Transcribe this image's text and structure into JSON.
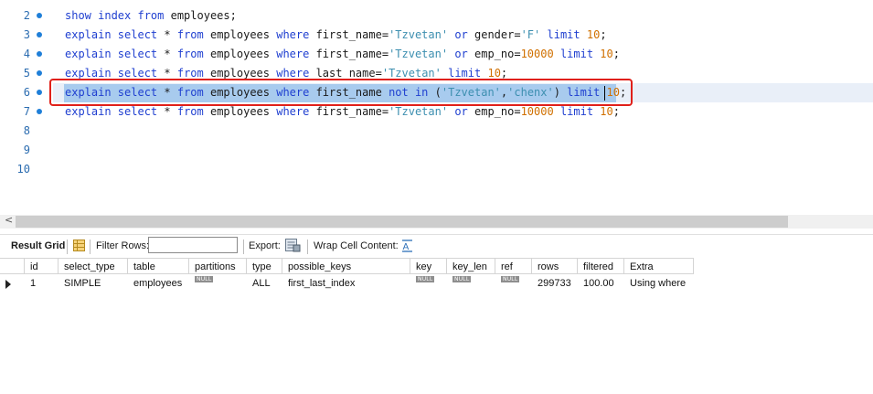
{
  "editor": {
    "lines": [
      {
        "num": "2",
        "marker": true,
        "tokens": [
          [
            "kw",
            "show index from"
          ],
          [
            "pl",
            " employees;"
          ]
        ]
      },
      {
        "num": "3",
        "marker": true,
        "tokens": [
          [
            "kw",
            "explain select"
          ],
          [
            "pl",
            " * "
          ],
          [
            "kw",
            "from"
          ],
          [
            "pl",
            " employees "
          ],
          [
            "kw",
            "where"
          ],
          [
            "pl",
            " first_name="
          ],
          [
            "st",
            "'Tzvetan'"
          ],
          [
            "pl",
            " "
          ],
          [
            "kw",
            "or"
          ],
          [
            "pl",
            " gender="
          ],
          [
            "st",
            "'F'"
          ],
          [
            "pl",
            " "
          ],
          [
            "kw",
            "limit"
          ],
          [
            "pl",
            " "
          ],
          [
            "nu",
            "10"
          ],
          [
            "pl",
            ";"
          ]
        ]
      },
      {
        "num": "4",
        "marker": true,
        "tokens": [
          [
            "kw",
            "explain select"
          ],
          [
            "pl",
            " * "
          ],
          [
            "kw",
            "from"
          ],
          [
            "pl",
            " employees "
          ],
          [
            "kw",
            "where"
          ],
          [
            "pl",
            " first_name="
          ],
          [
            "st",
            "'Tzvetan'"
          ],
          [
            "pl",
            " "
          ],
          [
            "kw",
            "or"
          ],
          [
            "pl",
            " emp_no="
          ],
          [
            "nu",
            "10000"
          ],
          [
            "pl",
            " "
          ],
          [
            "kw",
            "limit"
          ],
          [
            "pl",
            " "
          ],
          [
            "nu",
            "10"
          ],
          [
            "pl",
            ";"
          ]
        ]
      },
      {
        "num": "5",
        "marker": true,
        "tokens": [
          [
            "kw",
            "explain select"
          ],
          [
            "pl",
            " * "
          ],
          [
            "kw",
            "from"
          ],
          [
            "pl",
            " employees "
          ],
          [
            "kw",
            "where"
          ],
          [
            "pl",
            " last_name="
          ],
          [
            "st",
            "'Tzvetan'"
          ],
          [
            "pl",
            " "
          ],
          [
            "kw",
            "limit"
          ],
          [
            "pl",
            " "
          ],
          [
            "nu",
            "10"
          ],
          [
            "pl",
            ";"
          ]
        ]
      },
      {
        "num": "6",
        "marker": true,
        "selected": true,
        "tokens": [
          [
            "kw",
            "explain select"
          ],
          [
            "pl",
            " * "
          ],
          [
            "kw",
            "from"
          ],
          [
            "pl",
            " employees "
          ],
          [
            "kw",
            "where"
          ],
          [
            "pl",
            " first_name "
          ],
          [
            "kw",
            "not in"
          ],
          [
            "pl",
            " ("
          ],
          [
            "st",
            "'Tzvetan'"
          ],
          [
            "pl",
            ","
          ],
          [
            "st",
            "'chenx'"
          ],
          [
            "pl",
            ") "
          ],
          [
            "kw",
            "limit"
          ],
          [
            "pl",
            " "
          ],
          [
            "nu",
            "10"
          ],
          [
            "pl",
            ";"
          ]
        ]
      },
      {
        "num": "7",
        "marker": true,
        "tokens": [
          [
            "kw",
            "explain select"
          ],
          [
            "pl",
            " * "
          ],
          [
            "kw",
            "from"
          ],
          [
            "pl",
            " employees "
          ],
          [
            "kw",
            "where"
          ],
          [
            "pl",
            " first_name="
          ],
          [
            "st",
            "'Tzvetan'"
          ],
          [
            "pl",
            " "
          ],
          [
            "kw",
            "or"
          ],
          [
            "pl",
            " emp_no="
          ],
          [
            "nu",
            "10000"
          ],
          [
            "pl",
            " "
          ],
          [
            "kw",
            "limit"
          ],
          [
            "pl",
            " "
          ],
          [
            "nu",
            "10"
          ],
          [
            "pl",
            ";"
          ]
        ]
      },
      {
        "num": "8",
        "marker": false,
        "tokens": []
      },
      {
        "num": "9",
        "marker": false,
        "tokens": []
      },
      {
        "num": "10",
        "marker": false,
        "tokens": []
      }
    ],
    "colors": {
      "kw": "#1f3fd0",
      "st": "#3d8fb0",
      "nu": "#d07000",
      "pl": "#1a1a1a"
    }
  },
  "toolbar": {
    "result_grid_label": "Result Grid",
    "filter_rows_label": "Filter Rows:",
    "filter_rows_value": "",
    "export_label": "Export:",
    "wrap_label": "Wrap Cell Content:"
  },
  "grid": {
    "columns": [
      "id",
      "select_type",
      "table",
      "partitions",
      "type",
      "possible_keys",
      "key",
      "key_len",
      "ref",
      "rows",
      "filtered",
      "Extra"
    ],
    "null_label": "NULL",
    "rows": [
      [
        "1",
        "SIMPLE",
        "employees",
        null,
        "ALL",
        "first_last_index",
        null,
        null,
        null,
        "299733",
        "100.00",
        "Using where"
      ]
    ]
  }
}
